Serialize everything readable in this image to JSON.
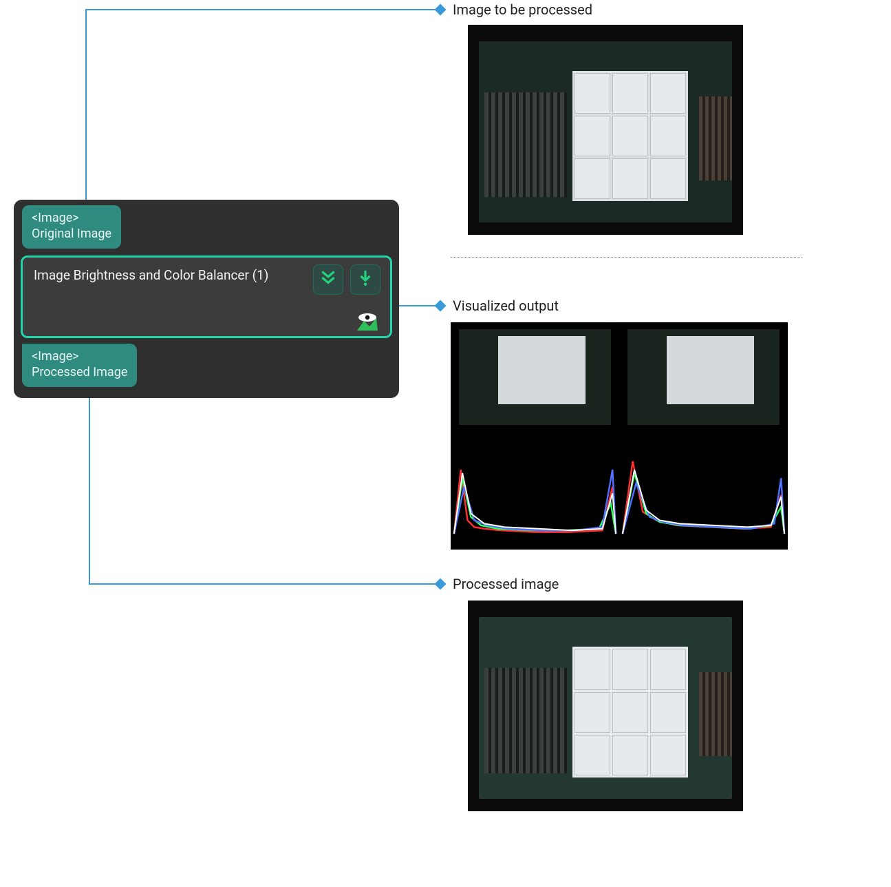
{
  "node": {
    "input_port": {
      "type": "<Image>",
      "name": "Original Image"
    },
    "title": "Image Brightness and Color Balancer (1)",
    "output_port": {
      "type": "<Image>",
      "name": "Processed Image"
    }
  },
  "labels": {
    "input": "Image to be processed",
    "visualized": "Visualized output",
    "processed": "Processed image"
  },
  "colors": {
    "accent": "#23d5ab",
    "teal": "#2f8a80",
    "connector": "#3a99d8",
    "panel": "#2f2f2f"
  },
  "icons": {
    "run_all": "run-all-icon",
    "run_once": "run-once-icon",
    "visualize": "visualize-icon"
  }
}
